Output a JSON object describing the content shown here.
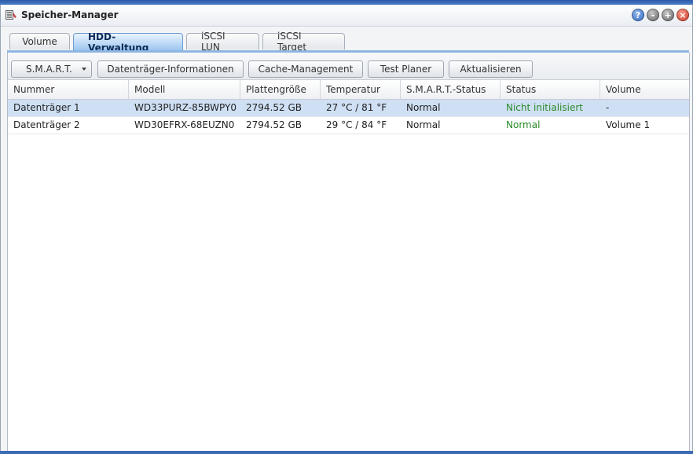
{
  "window": {
    "title": "Speicher-Manager",
    "icon": "storage-manager-icon",
    "buttons": {
      "help": "?",
      "minimize": "-",
      "maximize": "+",
      "close": "×"
    }
  },
  "tabs": [
    {
      "label": "Volume",
      "active": false
    },
    {
      "label": "HDD-Verwaltung",
      "active": true
    },
    {
      "label": "iSCSI LUN",
      "active": false
    },
    {
      "label": "iSCSI Target",
      "active": false
    }
  ],
  "toolbar": {
    "smart": "S.M.A.R.T.",
    "disk_info": "Datenträger-Informationen",
    "cache": "Cache-Management",
    "test_planer": "Test Planer",
    "refresh": "Aktualisieren"
  },
  "table": {
    "columns": [
      "Nummer",
      "Modell",
      "Plattengröße",
      "Temperatur",
      "S.M.A.R.T.-Status",
      "Status",
      "Volume"
    ],
    "rows": [
      {
        "nummer": "Datenträger 1",
        "modell": "WD33PURZ-85BWPY0",
        "groesse": "2794.52 GB",
        "temperatur": "27 °C / 81 °F",
        "smart": "Normal",
        "status": "Nicht initialisiert",
        "volume": "-",
        "selected": true
      },
      {
        "nummer": "Datenträger 2",
        "modell": "WD30EFRX-68EUZN0",
        "groesse": "2794.52 GB",
        "temperatur": "29 °C / 84 °F",
        "smart": "Normal",
        "status": "Normal",
        "volume": "Volume 1",
        "selected": false
      }
    ]
  },
  "colors": {
    "accent": "#8fb6e2",
    "status_ok": "#2a8a2a",
    "selected_row": "#cfe0f5"
  }
}
